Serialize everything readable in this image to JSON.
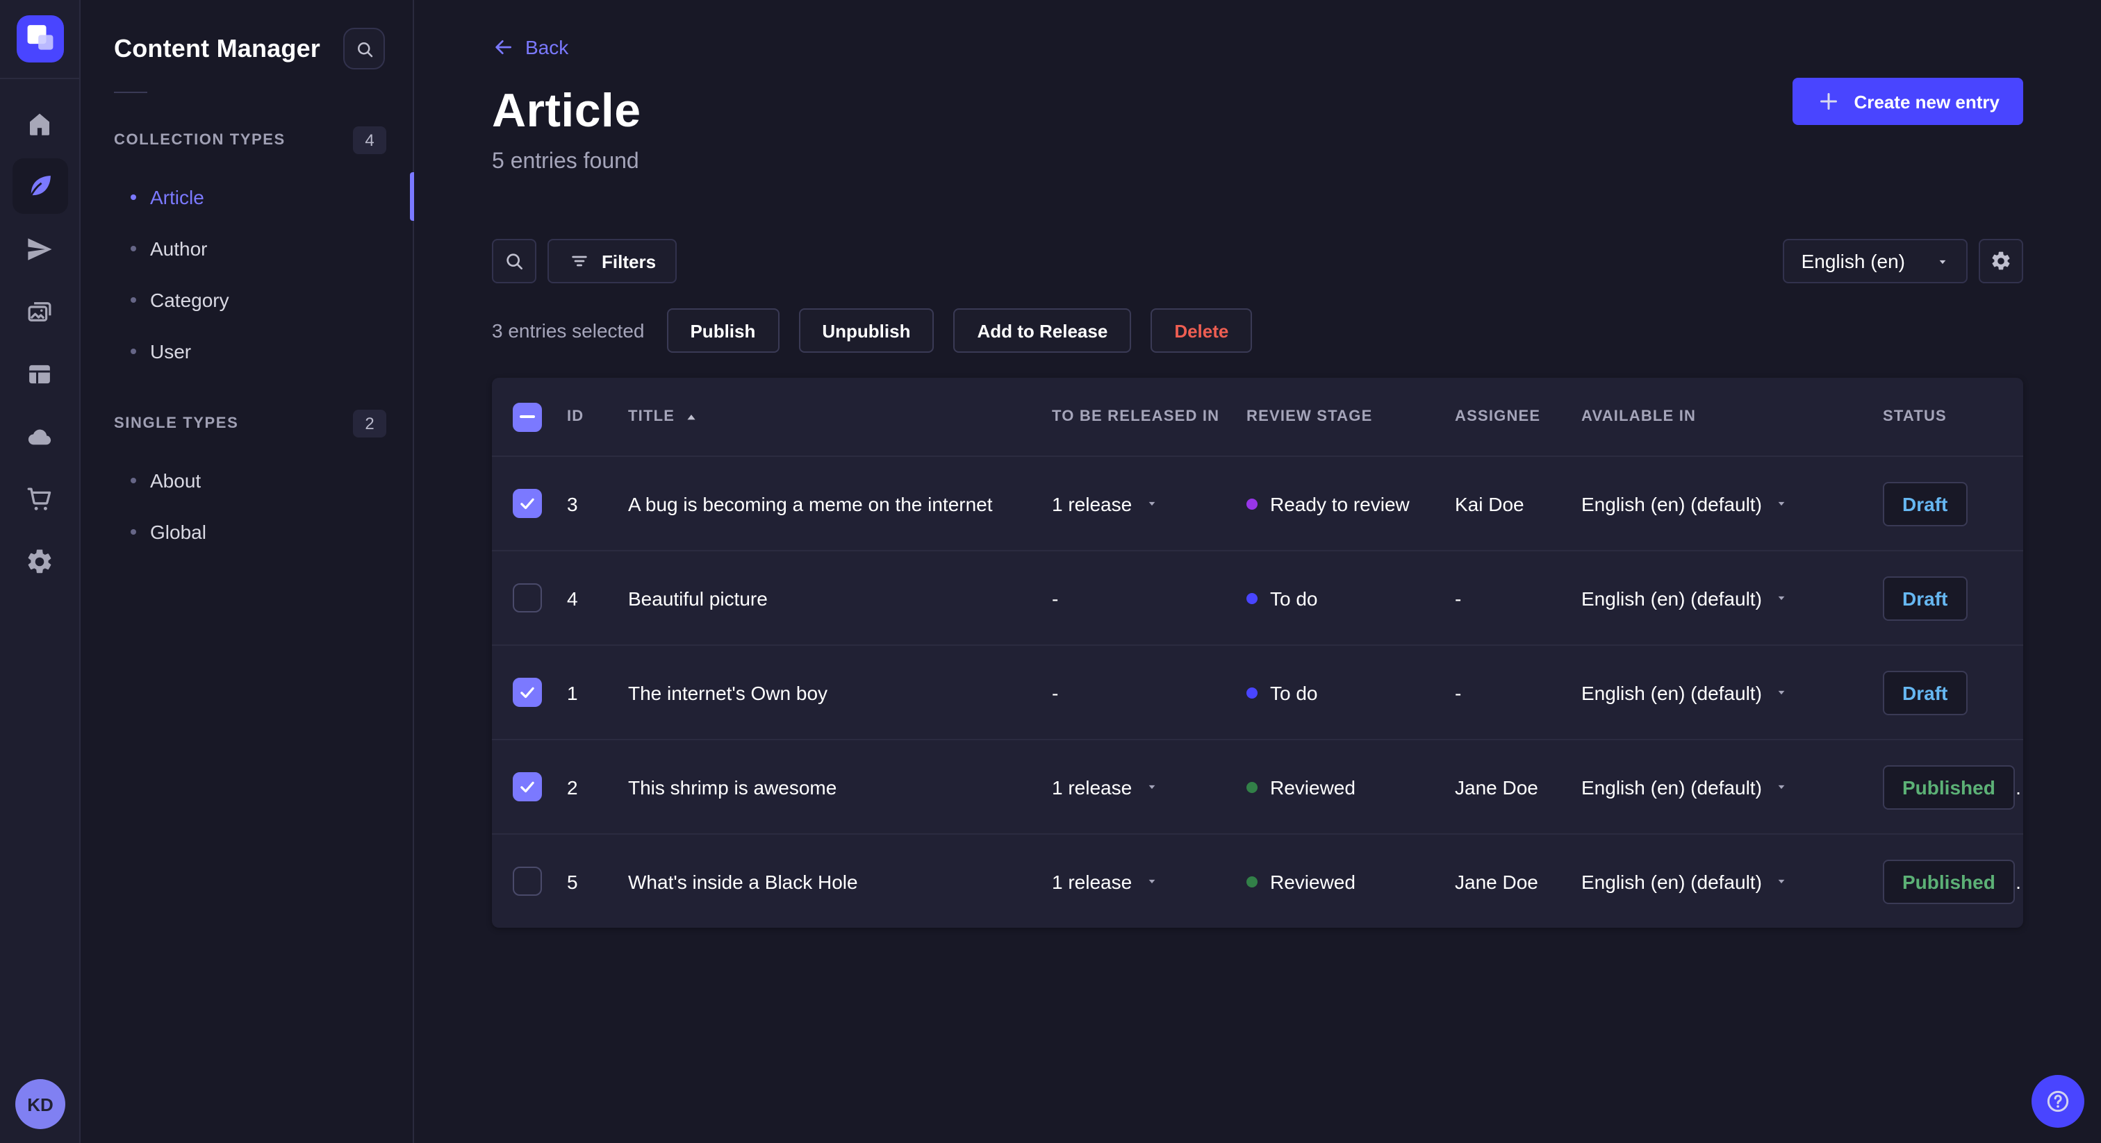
{
  "user": {
    "initials": "KD"
  },
  "subnav": {
    "title": "Content Manager",
    "sections": [
      {
        "label": "COLLECTION TYPES",
        "count": "4",
        "items": [
          {
            "label": "Article",
            "active": true
          },
          {
            "label": "Author",
            "active": false
          },
          {
            "label": "Category",
            "active": false
          },
          {
            "label": "User",
            "active": false
          }
        ]
      },
      {
        "label": "SINGLE TYPES",
        "count": "2",
        "items": [
          {
            "label": "About",
            "active": false
          },
          {
            "label": "Global",
            "active": false
          }
        ]
      }
    ]
  },
  "header": {
    "back_label": "Back",
    "title": "Article",
    "subtitle": "5 entries found",
    "create_label": "Create new entry"
  },
  "toolbar": {
    "filters_label": "Filters",
    "locale_value": "English (en)"
  },
  "selection": {
    "count_label": "3 entries selected",
    "publish_label": "Publish",
    "unpublish_label": "Unpublish",
    "add_release_label": "Add to Release",
    "delete_label": "Delete"
  },
  "table": {
    "columns": {
      "id": "ID",
      "title": "TITLE",
      "released": "TO BE RELEASED IN",
      "stage": "REVIEW STAGE",
      "assignee": "ASSIGNEE",
      "available": "AVAILABLE IN",
      "status": "STATUS"
    },
    "rows": [
      {
        "checked": true,
        "id": "3",
        "title": "A bug is becoming a meme on the internet",
        "release": "1 release",
        "stage": "Ready to review",
        "stage_color": "#9736e8",
        "assignee": "Kai Doe",
        "locale": "English (en) (default)",
        "status": "Draft",
        "status_kind": "draft"
      },
      {
        "checked": false,
        "id": "4",
        "title": "Beautiful picture",
        "release": "-",
        "stage": "To do",
        "stage_color": "#4945ff",
        "assignee": "-",
        "locale": "English (en) (default)",
        "status": "Draft",
        "status_kind": "draft"
      },
      {
        "checked": true,
        "id": "1",
        "title": "The internet's Own boy",
        "release": "-",
        "stage": "To do",
        "stage_color": "#4945ff",
        "assignee": "-",
        "locale": "English (en) (default)",
        "status": "Draft",
        "status_kind": "draft"
      },
      {
        "checked": true,
        "id": "2",
        "title": "This shrimp is awesome",
        "release": "1 release",
        "stage": "Reviewed",
        "stage_color": "#328048",
        "assignee": "Jane Doe",
        "locale": "English (en) (default)",
        "status": "Published",
        "status_kind": "published"
      },
      {
        "checked": false,
        "id": "5",
        "title": "What's inside a Black Hole",
        "release": "1 release",
        "stage": "Reviewed",
        "stage_color": "#328048",
        "assignee": "Jane Doe",
        "locale": "English (en) (default)",
        "status": "Published",
        "status_kind": "published"
      }
    ]
  },
  "colors": {
    "accent": "#4945ff",
    "accent_light": "#7b79ff",
    "danger": "#ee5e52",
    "draft_text": "#66b7f1",
    "published_text": "#5cb176"
  }
}
